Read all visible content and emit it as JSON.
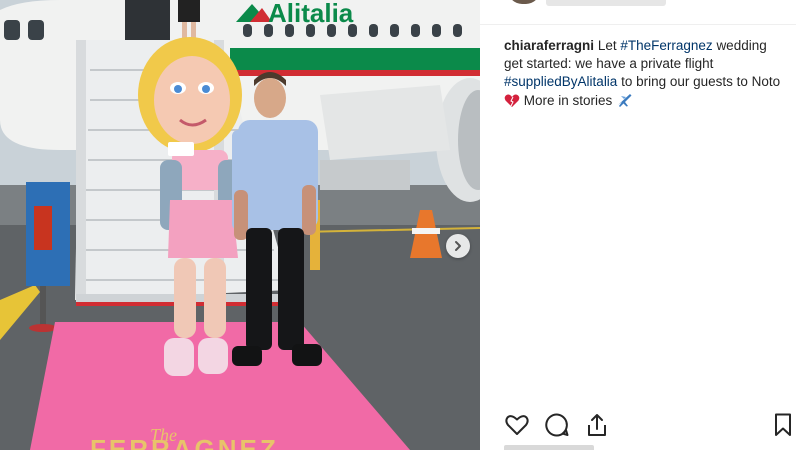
{
  "post": {
    "image_alt": "",
    "nav": {
      "next_icon": "chevron-right-icon"
    }
  },
  "caption": {
    "username": "chiaraferragni",
    "text_1": "Let",
    "hashtag_1": "#TheFerragnez",
    "text_2": "wedding get started: we have a private flight",
    "hashtag_2": "#suppliedByAlitalia",
    "text_3": "to bring our guests to Noto",
    "heart_emoji": "heart-emoji-icon",
    "text_4": "More in stories",
    "plane_emoji": "airplane-emoji-icon"
  },
  "actions": {
    "like_icon": "heart-icon",
    "comment_icon": "comment-icon",
    "share_icon": "share-icon",
    "save_icon": "bookmark-icon"
  },
  "colors": {
    "link": "#003569",
    "text": "#262626",
    "carpet": "#f16aa6",
    "alitalia_green": "#0b8a4a",
    "alitalia_red": "#d12d33"
  }
}
